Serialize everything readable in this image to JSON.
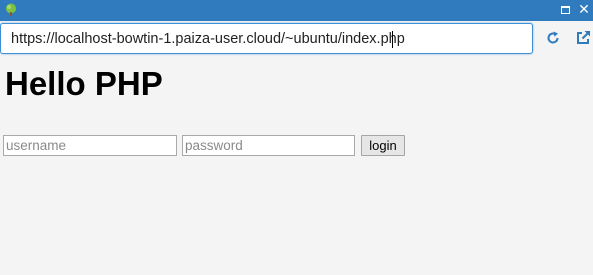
{
  "window": {
    "icon": "tree-icon",
    "maximize_icon": "maximize-icon",
    "close_icon": "close-icon",
    "close_glyph": "✕"
  },
  "browser": {
    "url": "https://localhost-bowtin-1.paiza-user.cloud/~ubuntu/index.php",
    "reload_icon": "reload-icon",
    "open_external_icon": "open-external-icon",
    "accent_color": "#2f7bbd"
  },
  "page": {
    "title": "Hello PHP",
    "form": {
      "username_placeholder": "username",
      "password_placeholder": "password",
      "login_label": "login"
    }
  }
}
